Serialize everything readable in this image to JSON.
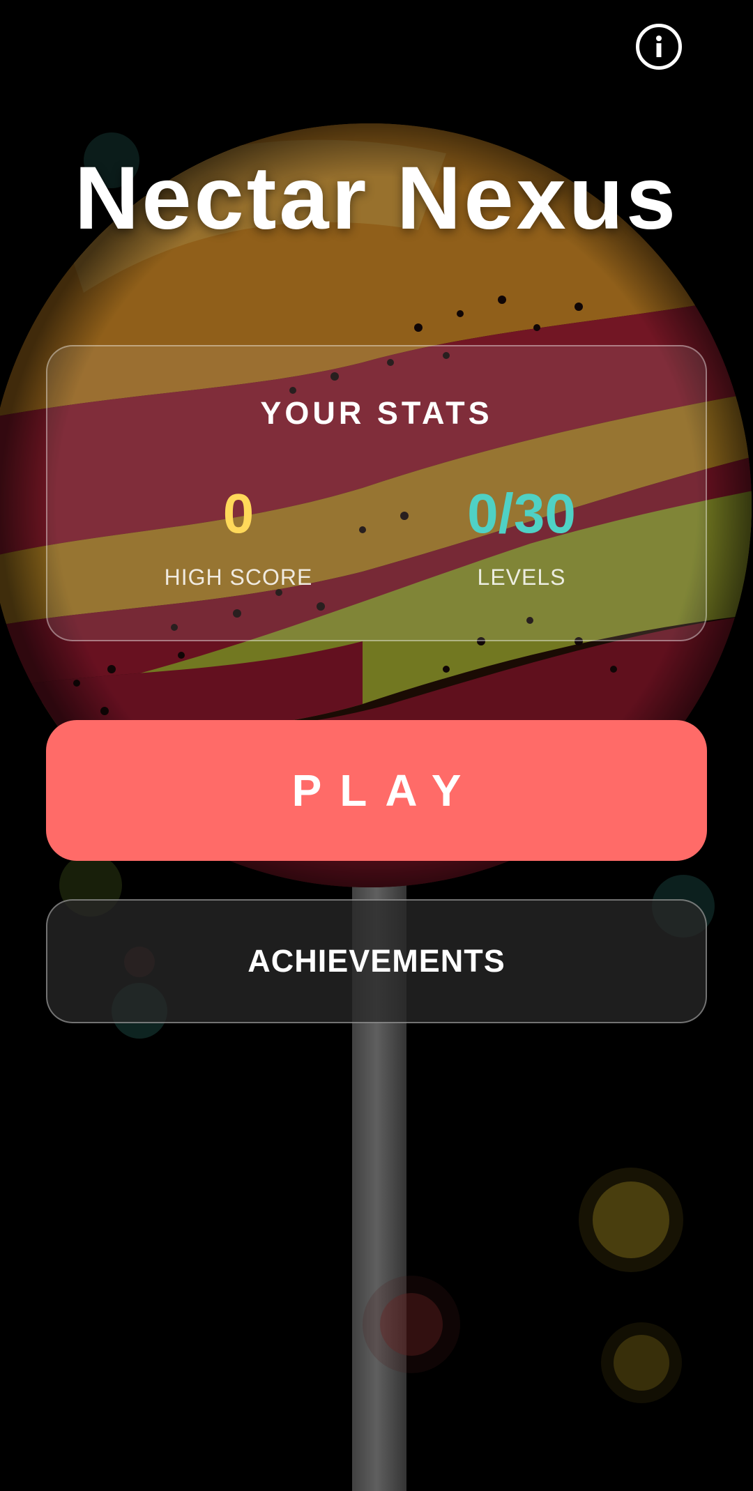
{
  "app": {
    "title": "Nectar Nexus"
  },
  "header": {
    "info_icon": "info-icon"
  },
  "stats": {
    "heading": "YOUR STATS",
    "high_score": {
      "value": "0",
      "label": "HIGH SCORE"
    },
    "levels": {
      "value": "0/30",
      "label": "LEVELS"
    }
  },
  "actions": {
    "play_label": "PLAY",
    "achievements_label": "ACHIEVEMENTS"
  },
  "colors": {
    "background": "#000000",
    "play_button": "#ff6b68",
    "high_score_value": "#ffd95a",
    "levels_value": "#4fd1c5",
    "text": "#ffffff"
  }
}
